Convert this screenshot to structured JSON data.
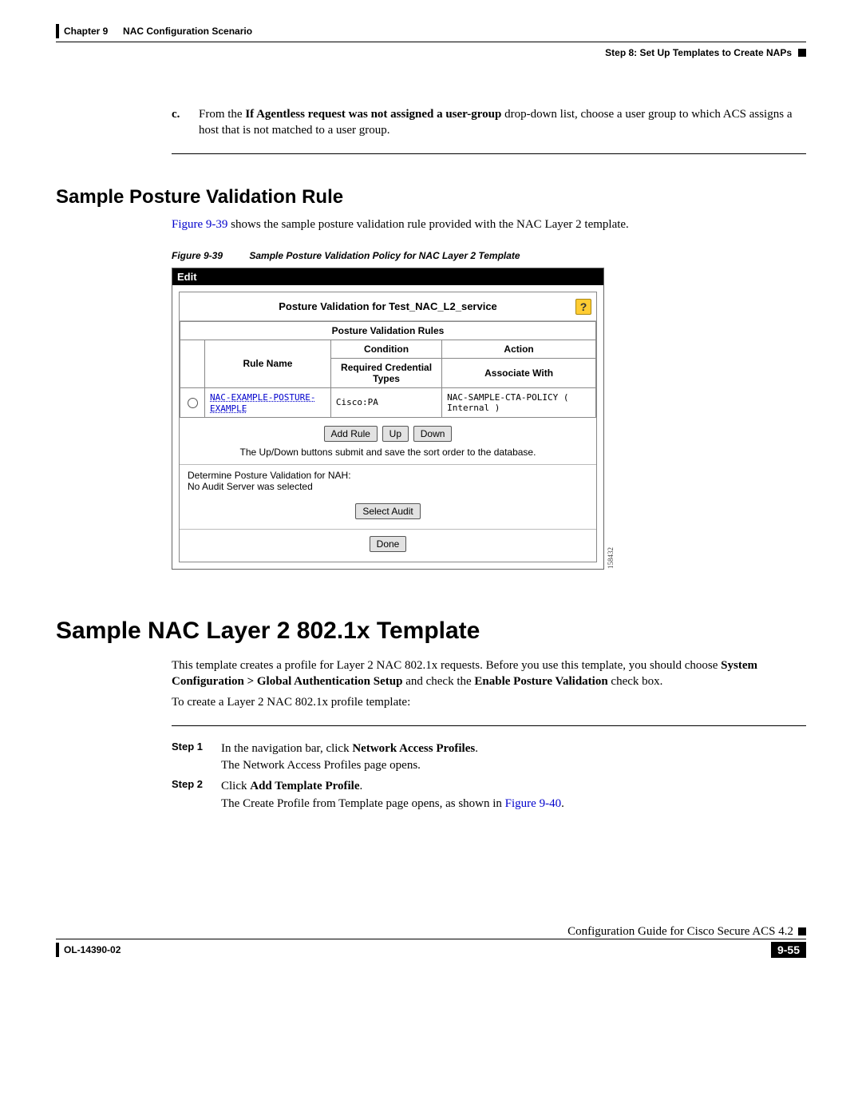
{
  "header": {
    "chapter": "Chapter 9",
    "chapter_title": "NAC Configuration Scenario",
    "step_label": "Step 8: Set Up Templates to Create NAPs"
  },
  "body": {
    "c_label": "c.",
    "c_fragments": {
      "pre": "From the ",
      "bold": "If Agentless request was not assigned a user-group",
      "post": " drop-down list, choose a user group to which ACS assigns a host that is not matched to a user group."
    },
    "section1_title": "Sample Posture Validation Rule",
    "section1_text_pre": " shows the sample posture validation rule provided with the NAC Layer 2 template.",
    "section1_figref": "Figure 9-39",
    "figure": {
      "caption_no": "Figure 9-39",
      "caption_text": "Sample Posture Validation Policy for NAC Layer 2 Template",
      "edit_label": "Edit",
      "title": "Posture Validation for Test_NAC_L2_service",
      "help_icon": "?",
      "rules_header": "Posture Validation Rules",
      "col_rule_name": "Rule Name",
      "col_condition": "Condition",
      "col_condition_sub": "Required Credential Types",
      "col_action": "Action",
      "col_action_sub": "Associate With",
      "row_rule_name": "NAC-EXAMPLE-POSTURE-EXAMPLE",
      "row_condition": "Cisco:PA",
      "row_action": "NAC-SAMPLE-CTA-POLICY ( Internal )",
      "btn_add": "Add Rule",
      "btn_up": "Up",
      "btn_down": "Down",
      "note": "The Up/Down buttons submit and save the sort order to the database.",
      "nah_line1": "Determine Posture Validation for NAH:",
      "nah_line2": "No Audit Server was selected",
      "btn_select_audit": "Select Audit",
      "btn_done": "Done",
      "side_code": "158432"
    },
    "section2_title": "Sample NAC Layer 2 802.1x Template",
    "section2_p1": {
      "pre": "This template creates a profile for Layer 2 NAC 802.1x requests. Before you use this template, you should choose ",
      "bold1": "System Configuration > Global Authentication Setup",
      "mid": " and check the ",
      "bold2": "Enable Posture Validation",
      "post": " check box."
    },
    "section2_p2": "To create a Layer 2 NAC 802.1x profile template:",
    "steps": [
      {
        "label": "Step 1",
        "line1_pre": "In the navigation bar, click ",
        "line1_bold": "Network Access Profiles",
        "line1_post": ".",
        "line2": "The Network Access Profiles page opens."
      },
      {
        "label": "Step 2",
        "line1_pre": "Click ",
        "line1_bold": "Add Template Profile",
        "line1_post": ".",
        "line2_pre": "The Create Profile from Template page opens, as shown in ",
        "line2_link": "Figure 9-40",
        "line2_post": "."
      }
    ]
  },
  "footer": {
    "doc_id": "OL-14390-02",
    "guide_title": "Configuration Guide for Cisco Secure ACS 4.2",
    "page_number": "9-55"
  }
}
